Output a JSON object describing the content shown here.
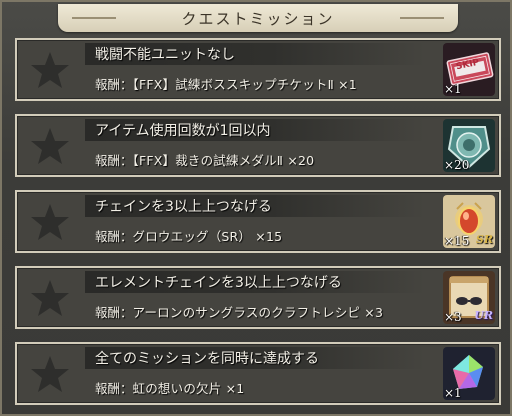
{
  "header": {
    "title": "クエストミッション"
  },
  "missions": [
    {
      "title": "戦闘不能ユニットなし",
      "reward_label": "報酬：",
      "reward_item": "【FFX】試練ボススキップチケットⅡ ×1",
      "icon": "skip-ticket-icon",
      "icon_text": "SKIP",
      "quantity": "×1",
      "rarity": ""
    },
    {
      "title": "アイテム使用回数が1回以内",
      "reward_label": "報酬：",
      "reward_item": "【FFX】裁きの試練メダルⅡ ×20",
      "icon": "trial-medal-icon",
      "quantity": "×20",
      "rarity": ""
    },
    {
      "title": "チェインを3以上上つなげる",
      "reward_label": "報酬：",
      "reward_item": "グロウエッグ（SR） ×15",
      "icon": "grow-egg-icon",
      "quantity": "×15",
      "rarity": "SR"
    },
    {
      "title": "エレメントチェインを3以上上つなげる",
      "reward_label": "報酬：",
      "reward_item": "アーロンのサングラスのクラフトレシピ ×3",
      "icon": "craft-recipe-icon",
      "quantity": "×3",
      "rarity": "UR"
    },
    {
      "title": "全てのミッションを同時に達成する",
      "reward_label": "報酬：",
      "reward_item": "虹の想いの欠片 ×1",
      "icon": "rainbow-crystal-icon",
      "quantity": "×1",
      "rarity": ""
    }
  ],
  "colors": {
    "background": "#3a3a37",
    "panel_border": "#d2ccba",
    "star": "#2e2e2c",
    "text": "#f2efe6"
  }
}
